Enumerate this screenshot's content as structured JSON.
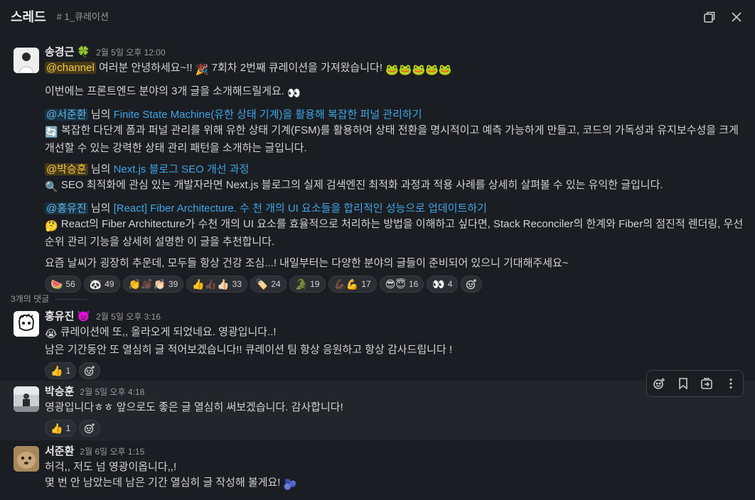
{
  "header": {
    "title": "스레드",
    "channel": "# 1_큐레이션"
  },
  "parent": {
    "author": "송경근",
    "author_emoji": "🍀",
    "time": "2월 5일 오후 12:00",
    "channel_mention": "@channel",
    "line1_a": " 여러분 안녕하세요~!! ",
    "line1_emoji": "🎉",
    "line1_b": " 7회차 2번째 큐레이션을 가져왔습니다! ",
    "line1_tail_emoji": "🐸🐸🐸🐸🐸",
    "line2": "이번에는 프론트엔드 분야의 3개 글을 소개해드릴게요. ",
    "line2_emoji": "👀",
    "items": [
      {
        "mention": "@서준환",
        "nim": " 님의 ",
        "link": "Finite State Machine(유한 상태 기계)을 활용해 복잡한 퍼널 관리하기",
        "emoji": "🔄",
        "desc1": " 복잡한 다단계 폼과 퍼널 관리를 위해 유한 상태 기계(FSM)를 활용하여 상태 전환을 명시적이고 예측 가능하게 만들고, 코드의 가독성과 유지보수성을 크게",
        "desc2": "개선할 수 있는 강력한 상태 관리 패턴을 소개하는 글입니다."
      },
      {
        "mention": "@박승훈",
        "nim": " 님의 ",
        "link": "Next.js 블로그 SEO 개선 과정",
        "emoji": "🔍",
        "desc1": " SEO 최적화에 관심 있는 개발자라면 Next.js 블로그의 실제 검색엔진 최적화 과정과 적용 사례를 상세히 살펴볼 수 있는 유익한 글입니다.",
        "desc2": ""
      },
      {
        "mention": "@홍유진",
        "nim": " 님의 ",
        "link": "[React] Fiber Architecture. 수 천 개의 UI 요소들을 합리적인 성능으로 업데이트하기",
        "emoji": "🤔",
        "desc1": " React의 Fiber Architecture가 수천 개의 UI 요소를 효율적으로 처리하는 방법을 이해하고 싶다면, Stack Reconciler의 한계와 Fiber의 점진적 렌더링, 우선",
        "desc2": "순위 관리 기능을 상세히 설명한 이 글을 추천합니다."
      }
    ],
    "closing": "요즘 날씨가 굉장히 추운데, 모두들 항상 건강 조심...! 내일부터는 다양한 분야의 글들이 준비되어 있으니 기대해주세요~",
    "reactions": [
      {
        "emoji": "🍉",
        "count": "56"
      },
      {
        "emoji": "🐼",
        "count": "49"
      },
      {
        "emoji": "👏👏🏿👏🏻",
        "count": "39"
      },
      {
        "emoji": "👍👍🏿👍🏻",
        "count": "33"
      },
      {
        "emoji": "🏷️",
        "count": "24"
      },
      {
        "emoji": "🐊",
        "count": "19"
      },
      {
        "emoji": "💪🏿💪",
        "count": "17"
      },
      {
        "emoji": "😎😇",
        "count": "16"
      },
      {
        "emoji": "👀",
        "count": "4"
      }
    ]
  },
  "replies_label": "3개의 댓글",
  "replies": [
    {
      "author": "홍유진",
      "author_emoji": "👿",
      "time": "2월 5일 오후 3:16",
      "line1_emoji": "😭",
      "line1": " 큐레이션에 또,, 올라오게 되었네요. 영광입니다..!",
      "line2": "남은 기간동안 또 열심히 글 적어보겠습니다!! 큐레이션 팀 항상 응원하고 항상 감사드립니다 !",
      "reaction": {
        "emoji": "👍",
        "count": "1"
      }
    },
    {
      "author": "박승훈",
      "time": "2월 5일 오후 4:18",
      "line1": "영광입니다ㅎㅎ 앞으로도 좋은 글 열심히 써보겠습니다. 감사합니다!",
      "reaction": {
        "emoji": "👍",
        "count": "1"
      }
    },
    {
      "author": "서준환",
      "time": "2월 6일 오후 1:15",
      "line1": "허걱,, 저도 넘 영광이옵니다,,!",
      "line2": "몇 번 안 남았는데 남은 기간 열심히 글 작성해 볼게요! ",
      "line2_emoji": "🫐"
    }
  ],
  "icons": {
    "open_window": "open-in-window-icon",
    "close": "close-icon",
    "add_reaction": "add-reaction-icon",
    "bookmark": "bookmark-icon",
    "forward": "forward-icon",
    "more": "more-actions-icon"
  }
}
